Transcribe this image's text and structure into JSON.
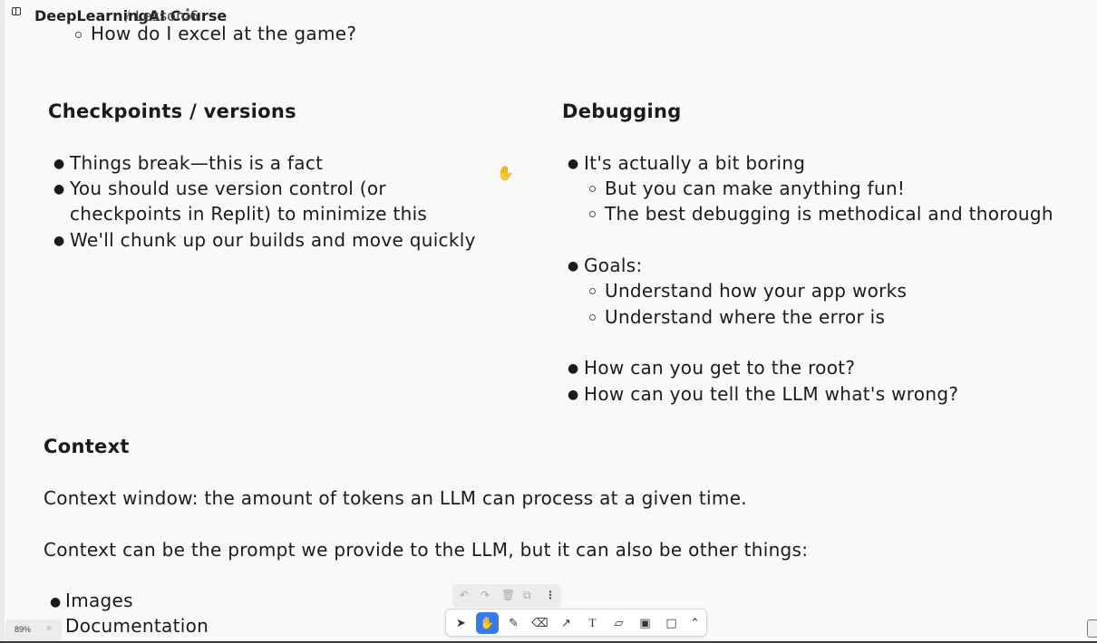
{
  "breadcrumb": {
    "course": "DeepLearningAI Course",
    "separator": "/",
    "lesson": "Lesson 6",
    "more": "⋮"
  },
  "top_item": "How do I excel at the game?",
  "checkpoints": {
    "title": "Checkpoints / versions",
    "bullets": [
      "Things break—this is a fact",
      "You should use version control (or",
      "checkpoints in Replit) to minimize this",
      "We'll chunk up our builds and move quickly"
    ]
  },
  "debugging": {
    "title": "Debugging",
    "b1": "It's actually a bit boring",
    "b1_sub": [
      "But you can make anything fun!",
      "The best debugging is methodical and thorough"
    ],
    "b2": "Goals:",
    "b2_sub": [
      "Understand how your app works",
      "Understand where the error is"
    ],
    "b3": "How can you get to the root?",
    "b4": "How can you tell the LLM what's wrong?"
  },
  "context": {
    "title": "Context",
    "p1": "Context window: the amount of tokens an LLM can process at a given time.",
    "p2": "Context can be the prompt we provide to the LLM, but it can also be other things:",
    "bullets": [
      "Images",
      "Documentation"
    ]
  },
  "zoom": {
    "level": "89%",
    "chevron": "»"
  },
  "mini_toolbar_icons": [
    "undo-icon",
    "redo-icon",
    "delete-icon",
    "duplicate-icon",
    "more-icon"
  ],
  "toolbar_tools": [
    "select",
    "hand",
    "draw",
    "eraser",
    "arrow",
    "text",
    "note",
    "media",
    "rectangle",
    "more"
  ],
  "active_tool": "hand",
  "colors": {
    "accent": "#2f7cf6",
    "background": "#f9f9f9",
    "ink": "#1b1b1b"
  }
}
